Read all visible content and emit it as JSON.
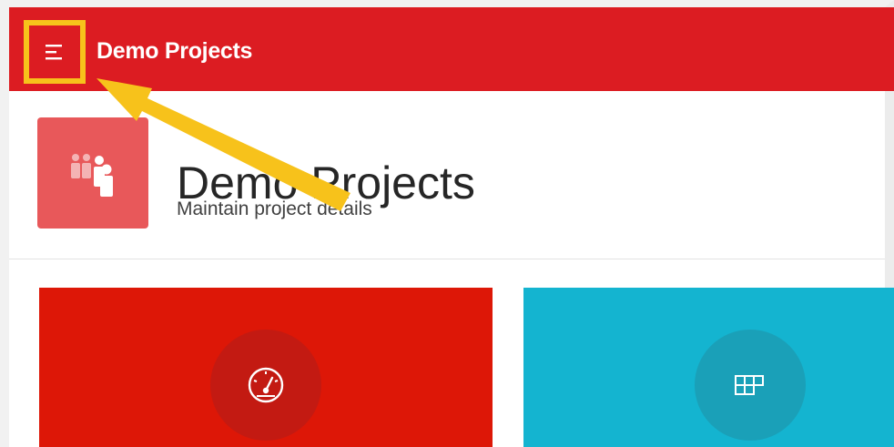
{
  "header": {
    "app_title": "Demo Projects",
    "menu_icon": "hamburger-menu-icon"
  },
  "hero": {
    "title": "Demo Projects",
    "subtitle": "Maintain project details",
    "icon": "users-icon",
    "icon_color": "#e8585a"
  },
  "cards": [
    {
      "icon": "dashboard-gauge-icon",
      "color": "#dd1707"
    },
    {
      "icon": "grid-table-icon",
      "color": "#14b4d0"
    }
  ],
  "annotation": {
    "highlight_color": "#f7c21b",
    "arrow_color": "#f7c21b"
  },
  "colors": {
    "header_bg": "#dc1c22",
    "accent": "#dc1c22"
  }
}
